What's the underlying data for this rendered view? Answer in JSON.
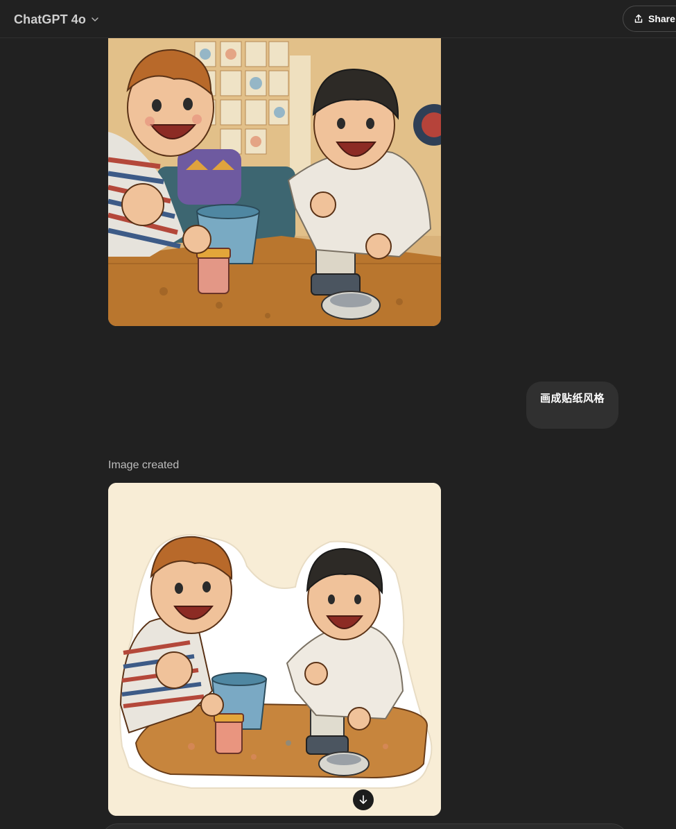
{
  "header": {
    "model_name": "ChatGPT 4o",
    "share_label": "Share"
  },
  "conversation": {
    "user_message": "画成贴纸风格",
    "assistant_status": "Image created"
  },
  "icons": {
    "model_chevron": "chevron-down-icon",
    "share": "share-upload-icon",
    "download": "arrow-down-icon"
  },
  "colors": {
    "background": "#212121",
    "user_bubble": "#303030",
    "sticker_background": "#f8edd6"
  }
}
